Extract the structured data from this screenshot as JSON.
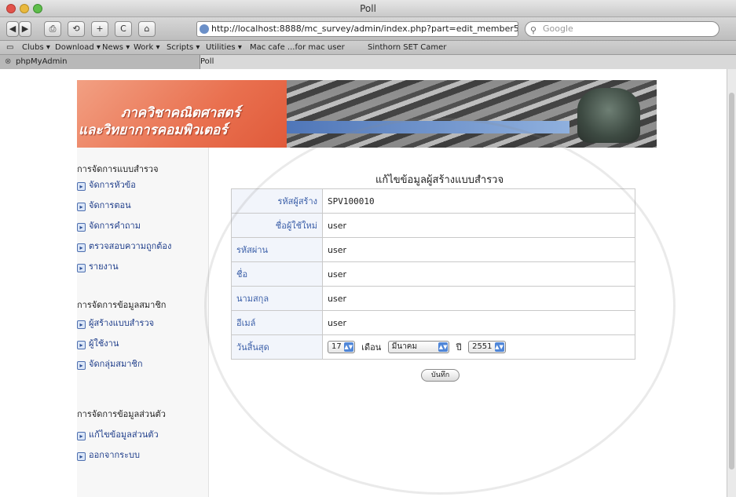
{
  "window": {
    "title": "Poll"
  },
  "toolbar": {
    "url": "http://localhost:8888/mc_survey/admin/index.php?part=edit_member5&id",
    "search_placeholder": "Google"
  },
  "bookmarks": [
    "Clubs ▾",
    "Download ▾",
    "News ▾",
    "Work ▾",
    "Scripts ▾",
    "Utilities ▾",
    "Mac cafe ...for mac user",
    "Sinthorn SET Camer"
  ],
  "tabs": [
    {
      "label": "phpMyAdmin"
    },
    {
      "label": "Poll"
    }
  ],
  "banner": {
    "line1": "ภาควิชาคณิตศาสตร์",
    "line2": "และวิทยาการคอมพิวเตอร์"
  },
  "sidebar": {
    "sections": [
      {
        "title": "การจัดการแบบสำรวจ",
        "items": [
          "จัดการหัวข้อ",
          "จัดการตอน",
          "จัดการคำถาม",
          "ตรวจสอบความถูกต้อง",
          "รายงาน"
        ]
      },
      {
        "title": "การจัดการข้อมูลสมาชิก",
        "items": [
          "ผู้สร้างแบบสำรวจ",
          "ผู้ใช้งาน",
          "จัดกลุ่มสมาชิก"
        ]
      },
      {
        "title": "การจัดการข้อมูลส่วนตัว",
        "items": [
          "แก้ไขข้อมูลส่วนตัว",
          "ออกจากระบบ"
        ]
      }
    ]
  },
  "form": {
    "title": "แก้ไขข้อมูลผู้สร้างแบบสำรวจ",
    "rows": [
      {
        "label": "รหัสผู้สร้าง",
        "value": "SPV100010"
      },
      {
        "label": "ชื่อผู้ใช้ใหม่",
        "value": "user"
      },
      {
        "label": "รหัสผ่าน",
        "value": "user"
      },
      {
        "label": "ชื่อ",
        "value": "user"
      },
      {
        "label": "นามสกุล",
        "value": "user"
      },
      {
        "label": "อีเมล์",
        "value": "user"
      }
    ],
    "expiry": {
      "label": "วันสิ้นสุด",
      "day": "17",
      "month_label": "เดือน",
      "month": "มีนาคม",
      "year_label": "ปี",
      "year": "2551"
    },
    "save_label": "บันทึก"
  }
}
